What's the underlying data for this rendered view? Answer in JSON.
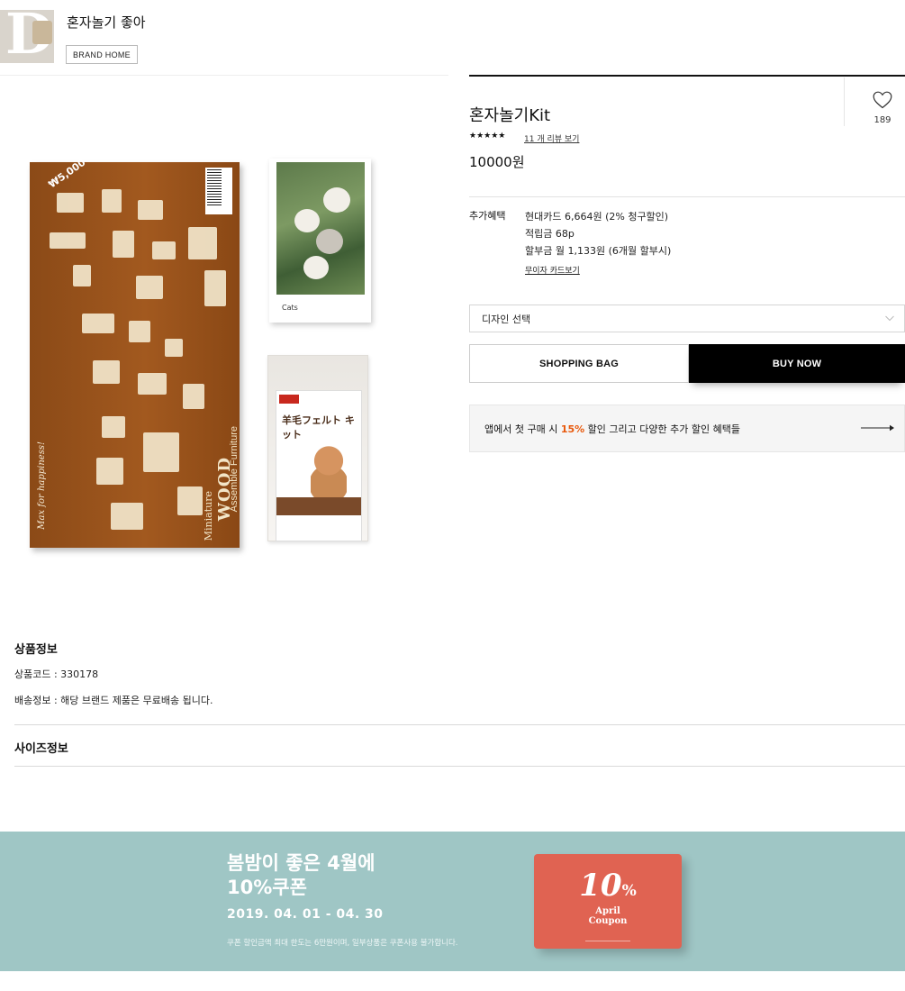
{
  "header": {
    "brand_name": "혼자놀기 좋아",
    "brand_home_label": "BRAND HOME",
    "logo_letter": "D"
  },
  "product": {
    "title": "혼자놀기Kit",
    "rating_stars": "★★★★★",
    "review_link": "11 개 리뷰 보기",
    "price": "10000원",
    "wish_count": "189",
    "image": {
      "board_price": "₩5,000",
      "board_title": "WOOD",
      "board_subtitle": "Assemble Furniture",
      "board_mini": "Miniature",
      "board_script": "Max for happiness!",
      "puzzle_brand": "Cats",
      "felt_title": "羊毛フェルト キット"
    }
  },
  "benefits": {
    "label": "추가혜택",
    "lines": [
      "현대카드 6,664원 (2% 청구할인)",
      "적립금 68p",
      "할부금 월 1,133원 (6개월 할부시)"
    ],
    "card_link": "무이자 카드보기"
  },
  "options": {
    "design_select_label": "디자인 선택"
  },
  "actions": {
    "shopping_bag": "SHOPPING BAG",
    "buy_now": "BUY NOW"
  },
  "app_banner": {
    "prefix": "앱에서 첫 구매 시 ",
    "highlight": "15%",
    "suffix": " 할인 그리고 다양한 추가 할인 혜택들",
    "highlight_color": "#e8590c"
  },
  "info": {
    "product_info_title": "상품정보",
    "product_code": "상품코드 : 330178",
    "shipping_info": "배송정보 : 해당 브랜드 제품은 무료배송 됩니다.",
    "size_info_title": "사이즈정보"
  },
  "coupon_banner": {
    "headline_1": "봄밤이 좋은 4월에",
    "headline_2": "10%쿠폰",
    "date": "2019. 04. 01 - 04. 30",
    "note": "쿠폰 할인금액 최대 한도는 6만원이며, 일부상품은 쿠폰사용 불가합니다.",
    "card_pct": "10",
    "card_pct_sign": "%",
    "card_line_1": "April",
    "card_line_2": "Coupon",
    "bg_color": "#9fc6c5",
    "card_color": "#e06352"
  },
  "icons": {
    "wish": "heart-icon",
    "select": "chevron-down-icon",
    "banner": "arrow-right-icon"
  }
}
